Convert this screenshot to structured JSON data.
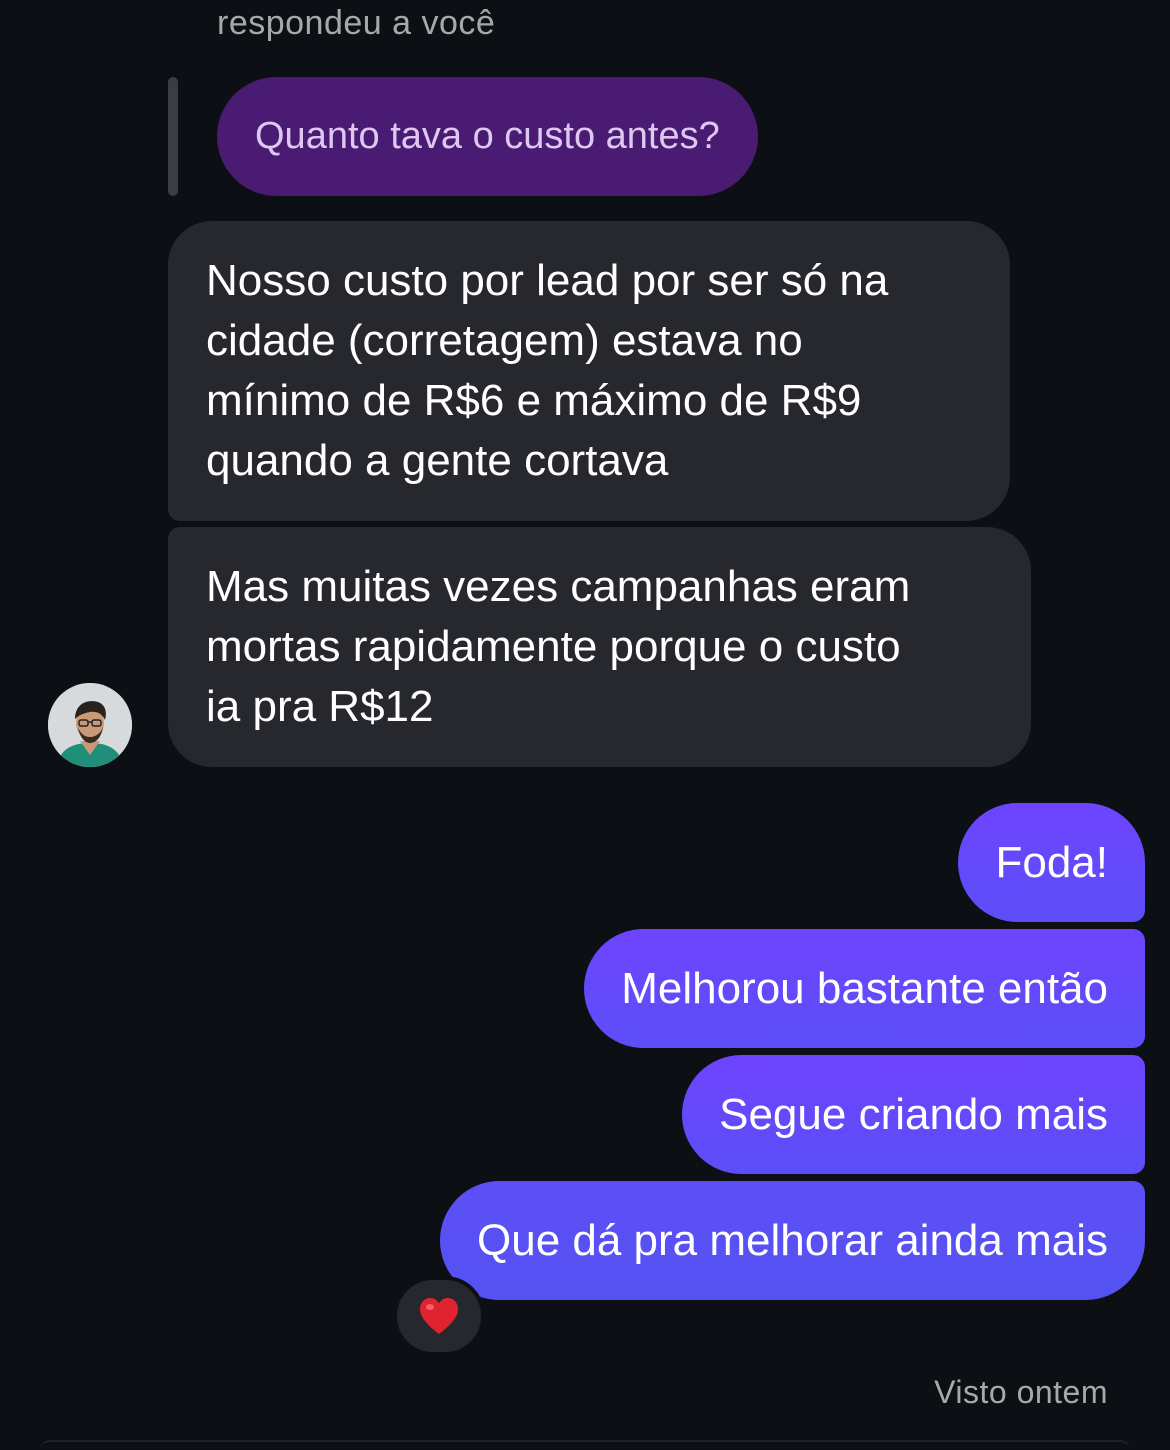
{
  "conversation": {
    "reply_context": "respondeu a você",
    "quoted_message": "Quanto tava o custo antes?",
    "incoming": [
      {
        "lines": [
          "Nosso custo por lead por ser só na",
          "cidade (corretagem) estava no",
          "mínimo de R$6 e máximo de R$9",
          "quando a gente cortava"
        ]
      },
      {
        "lines": [
          "Mas muitas vezes campanhas eram",
          "mortas rapidamente porque o custo",
          "ia pra R$12"
        ]
      }
    ],
    "outgoing": [
      "Foda!",
      "Melhorou bastante então",
      "Segue criando mais",
      "Que dá pra melhorar ainda mais"
    ],
    "reaction": {
      "icon": "heart-icon",
      "color": "#e0242f"
    },
    "seen_status": "Visto ontem"
  },
  "colors": {
    "background": "#0c1014",
    "incoming_bubble": "#26282d",
    "quoted_bubble": "#4a1b72",
    "outgoing_bubble": "#6443fb"
  }
}
